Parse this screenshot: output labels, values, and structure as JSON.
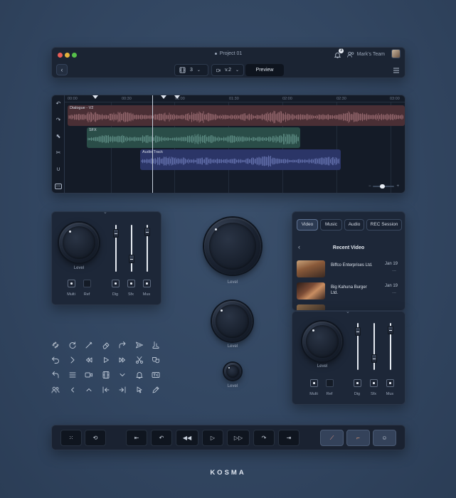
{
  "window": {
    "title": "Project 01",
    "team": "Mark's Team",
    "notification_count": "3",
    "clip_count": "3",
    "version": "v.2",
    "preview_label": "Preview",
    "traffic_lights": [
      "#e85d57",
      "#e3b23c",
      "#56c04a"
    ]
  },
  "timeline": {
    "ticks": [
      "00:00",
      "00:30",
      "01:00",
      "01:30",
      "02:00",
      "02:30",
      "03:00"
    ],
    "tracks": [
      {
        "label": "Dialogue - V2",
        "color": "#5b3a3f"
      },
      {
        "label": "SFX",
        "color": "#2f5a52"
      },
      {
        "label": "Audio Track",
        "color": "#323f7a"
      }
    ],
    "zoom_minus": "−",
    "zoom_plus": "+"
  },
  "mixer_left": {
    "level_label": "Level",
    "checks": [
      {
        "label": "Multi",
        "on": true
      },
      {
        "label": "Ref",
        "on": false
      },
      {
        "label": "Dig",
        "on": true
      },
      {
        "label": "Sfx",
        "on": true
      },
      {
        "label": "Mus",
        "on": true
      }
    ],
    "faders": [
      0.15,
      0.75,
      0.1
    ]
  },
  "knobs_center": {
    "large_label": "Level",
    "medium_label": "Level",
    "small_label": "Level"
  },
  "media": {
    "tabs": [
      "Video",
      "Music",
      "Audio",
      "REC Session"
    ],
    "active_tab": "Video",
    "title": "Recent Video",
    "items": [
      {
        "name": "Biffco Enterprises Ltd.",
        "date": "Jan 19",
        "more": "..."
      },
      {
        "name": "Big Kahuna Burger Ltd.",
        "date": "Jan 19",
        "more": "..."
      }
    ]
  },
  "mixer_right": {
    "level_label": "Level",
    "checks": [
      {
        "label": "Multi",
        "on": true
      },
      {
        "label": "Ref",
        "on": false
      },
      {
        "label": "Dig",
        "on": true
      },
      {
        "label": "Sfx",
        "on": true
      },
      {
        "label": "Mus",
        "on": true
      }
    ],
    "faders": [
      0.15,
      0.75,
      0.1
    ]
  },
  "icon_grid": [
    [
      "sparkle-icon",
      "refresh-icon",
      "magic-wand-icon",
      "eraser-icon",
      "redo-arrow-icon",
      "send-icon",
      "boot-icon"
    ],
    [
      "undo-arrow-icon",
      "skip-forward-icon",
      "rewind-icon",
      "play-icon",
      "fast-forward-icon",
      "scissors-icon",
      "masks-icon"
    ],
    [
      "share-arrow-icon",
      "menu-icon",
      "video-camera-icon",
      "film-icon",
      "chevron-down-icon",
      "bell-icon",
      "tc-icon"
    ],
    [
      "people-icon",
      "chevron-left-icon",
      "chevron-up-icon",
      "skip-back-icon",
      "skip-end-icon",
      "cursor-icon",
      "pen-icon"
    ]
  ],
  "brand": "KOSMA"
}
